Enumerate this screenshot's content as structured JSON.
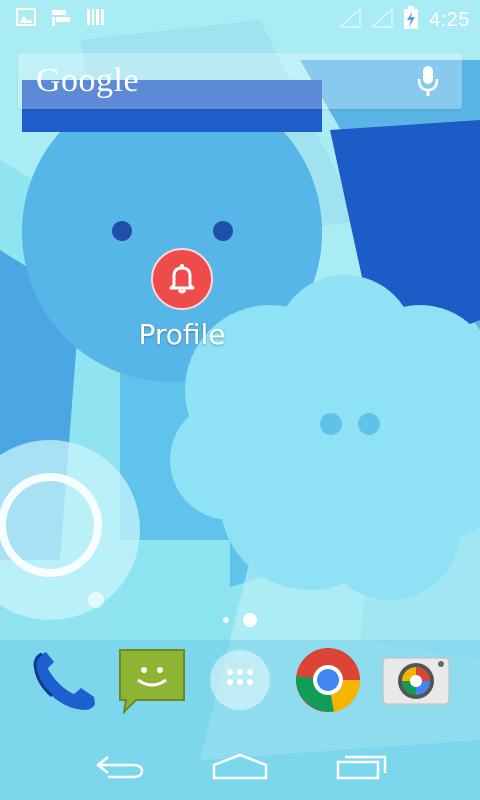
{
  "status_bar": {
    "time": "4:25",
    "left_icons": [
      "image-icon",
      "notification-icon",
      "barcode-icon"
    ],
    "right_icons": [
      "signal-icon",
      "signal-icon",
      "battery-charging-icon"
    ]
  },
  "search": {
    "logo_text": "Google",
    "mic_icon": "microphone-icon"
  },
  "home_apps": [
    {
      "label": "Profile",
      "icon": "bell-icon",
      "color": "#ee4b4b"
    }
  ],
  "page_indicator": {
    "pages": 2,
    "current": 2
  },
  "dock": [
    {
      "name": "phone",
      "icon": "phone-icon"
    },
    {
      "name": "messaging",
      "icon": "messaging-icon"
    },
    {
      "name": "app-drawer",
      "icon": "app-drawer-icon"
    },
    {
      "name": "chrome",
      "icon": "chrome-icon"
    },
    {
      "name": "camera",
      "icon": "camera-icon"
    }
  ],
  "nav_bar": [
    "back-icon",
    "home-icon",
    "recents-icon"
  ]
}
